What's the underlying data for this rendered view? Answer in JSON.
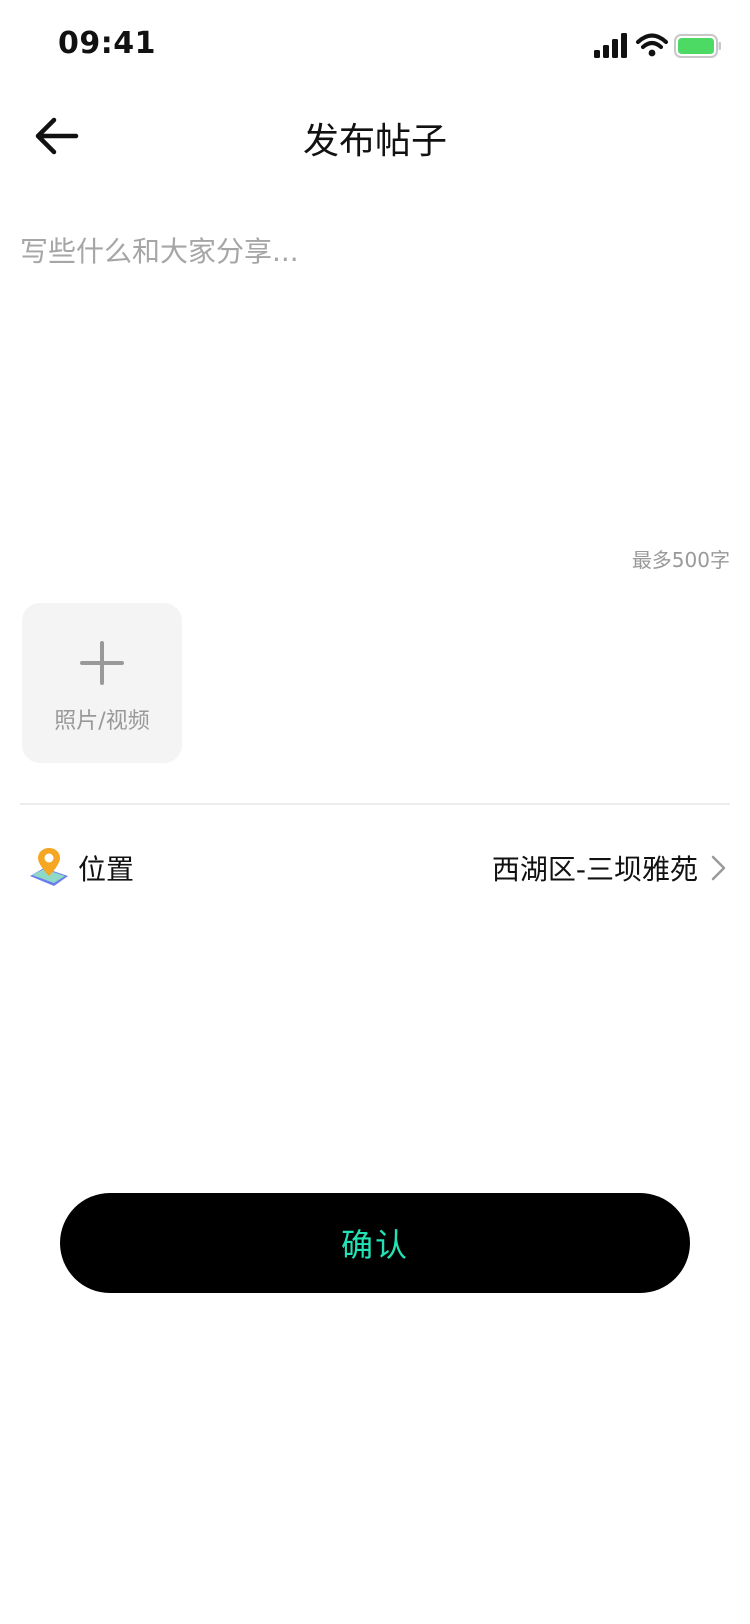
{
  "status_bar": {
    "time": "09:41",
    "icons": [
      "cellular-signal-icon",
      "wifi-icon",
      "battery-icon"
    ],
    "battery_color": "#4cd964"
  },
  "nav": {
    "back_icon": "arrow-left-icon",
    "title": "发布帖子"
  },
  "editor": {
    "placeholder": "写些什么和大家分享...",
    "value": "",
    "limit_text": "最多500字"
  },
  "media": {
    "icon": "plus-icon",
    "label": "照片/视频"
  },
  "location": {
    "icon": "map-pin-icon",
    "label": "位置",
    "value": "西湖区-三坝雅苑",
    "chevron": "chevron-right-icon"
  },
  "confirm": {
    "label": "确认",
    "bg_color": "#000000",
    "text_color": "#22e3b5"
  }
}
